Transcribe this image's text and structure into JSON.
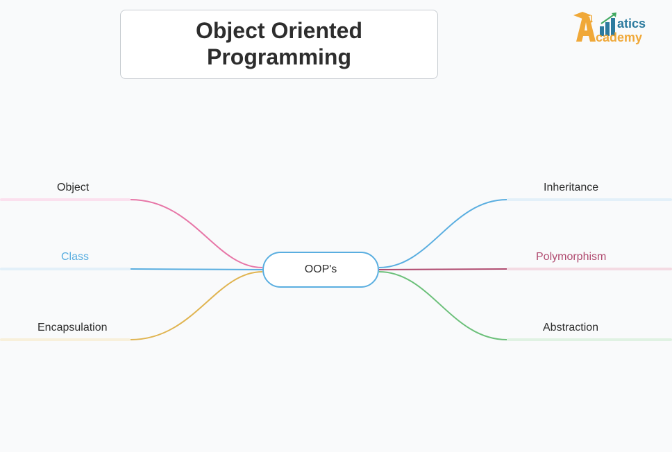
{
  "title": "Object Oriented Programming",
  "logo": {
    "text_top": "atics",
    "text_bottom": "cademy"
  },
  "center": {
    "label": "OOP's"
  },
  "left_nodes": [
    {
      "key": "object",
      "label": "Object",
      "color": "#e776a7",
      "underline": "#fbe0ee"
    },
    {
      "key": "class",
      "label": "Class",
      "color": "#5aaee0",
      "underline": "#e3f0f9",
      "label_color": "#5aaee0"
    },
    {
      "key": "encapsulation",
      "label": "Encapsulation",
      "color": "#e0b450",
      "underline": "#f8f0db"
    }
  ],
  "right_nodes": [
    {
      "key": "inheritance",
      "label": "Inheritance",
      "color": "#5aaee0",
      "underline": "#e3f0f9"
    },
    {
      "key": "polymorphism",
      "label": "Polymorphism",
      "color": "#b04a6f",
      "underline": "#f4dbe3",
      "label_color": "#b04a6f"
    },
    {
      "key": "abstraction",
      "label": "Abstraction",
      "color": "#6cc07a",
      "underline": "#e0f2e3"
    }
  ]
}
